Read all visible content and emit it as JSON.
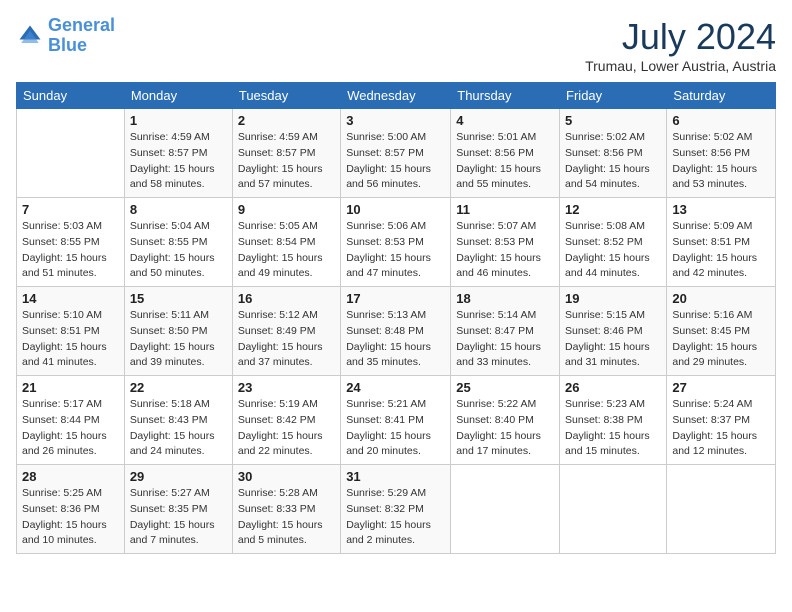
{
  "header": {
    "logo_line1": "General",
    "logo_line2": "Blue",
    "month": "July 2024",
    "location": "Trumau, Lower Austria, Austria"
  },
  "days_of_week": [
    "Sunday",
    "Monday",
    "Tuesday",
    "Wednesday",
    "Thursday",
    "Friday",
    "Saturday"
  ],
  "weeks": [
    [
      {
        "num": "",
        "info": ""
      },
      {
        "num": "1",
        "info": "Sunrise: 4:59 AM\nSunset: 8:57 PM\nDaylight: 15 hours\nand 58 minutes."
      },
      {
        "num": "2",
        "info": "Sunrise: 4:59 AM\nSunset: 8:57 PM\nDaylight: 15 hours\nand 57 minutes."
      },
      {
        "num": "3",
        "info": "Sunrise: 5:00 AM\nSunset: 8:57 PM\nDaylight: 15 hours\nand 56 minutes."
      },
      {
        "num": "4",
        "info": "Sunrise: 5:01 AM\nSunset: 8:56 PM\nDaylight: 15 hours\nand 55 minutes."
      },
      {
        "num": "5",
        "info": "Sunrise: 5:02 AM\nSunset: 8:56 PM\nDaylight: 15 hours\nand 54 minutes."
      },
      {
        "num": "6",
        "info": "Sunrise: 5:02 AM\nSunset: 8:56 PM\nDaylight: 15 hours\nand 53 minutes."
      }
    ],
    [
      {
        "num": "7",
        "info": "Sunrise: 5:03 AM\nSunset: 8:55 PM\nDaylight: 15 hours\nand 51 minutes."
      },
      {
        "num": "8",
        "info": "Sunrise: 5:04 AM\nSunset: 8:55 PM\nDaylight: 15 hours\nand 50 minutes."
      },
      {
        "num": "9",
        "info": "Sunrise: 5:05 AM\nSunset: 8:54 PM\nDaylight: 15 hours\nand 49 minutes."
      },
      {
        "num": "10",
        "info": "Sunrise: 5:06 AM\nSunset: 8:53 PM\nDaylight: 15 hours\nand 47 minutes."
      },
      {
        "num": "11",
        "info": "Sunrise: 5:07 AM\nSunset: 8:53 PM\nDaylight: 15 hours\nand 46 minutes."
      },
      {
        "num": "12",
        "info": "Sunrise: 5:08 AM\nSunset: 8:52 PM\nDaylight: 15 hours\nand 44 minutes."
      },
      {
        "num": "13",
        "info": "Sunrise: 5:09 AM\nSunset: 8:51 PM\nDaylight: 15 hours\nand 42 minutes."
      }
    ],
    [
      {
        "num": "14",
        "info": "Sunrise: 5:10 AM\nSunset: 8:51 PM\nDaylight: 15 hours\nand 41 minutes."
      },
      {
        "num": "15",
        "info": "Sunrise: 5:11 AM\nSunset: 8:50 PM\nDaylight: 15 hours\nand 39 minutes."
      },
      {
        "num": "16",
        "info": "Sunrise: 5:12 AM\nSunset: 8:49 PM\nDaylight: 15 hours\nand 37 minutes."
      },
      {
        "num": "17",
        "info": "Sunrise: 5:13 AM\nSunset: 8:48 PM\nDaylight: 15 hours\nand 35 minutes."
      },
      {
        "num": "18",
        "info": "Sunrise: 5:14 AM\nSunset: 8:47 PM\nDaylight: 15 hours\nand 33 minutes."
      },
      {
        "num": "19",
        "info": "Sunrise: 5:15 AM\nSunset: 8:46 PM\nDaylight: 15 hours\nand 31 minutes."
      },
      {
        "num": "20",
        "info": "Sunrise: 5:16 AM\nSunset: 8:45 PM\nDaylight: 15 hours\nand 29 minutes."
      }
    ],
    [
      {
        "num": "21",
        "info": "Sunrise: 5:17 AM\nSunset: 8:44 PM\nDaylight: 15 hours\nand 26 minutes."
      },
      {
        "num": "22",
        "info": "Sunrise: 5:18 AM\nSunset: 8:43 PM\nDaylight: 15 hours\nand 24 minutes."
      },
      {
        "num": "23",
        "info": "Sunrise: 5:19 AM\nSunset: 8:42 PM\nDaylight: 15 hours\nand 22 minutes."
      },
      {
        "num": "24",
        "info": "Sunrise: 5:21 AM\nSunset: 8:41 PM\nDaylight: 15 hours\nand 20 minutes."
      },
      {
        "num": "25",
        "info": "Sunrise: 5:22 AM\nSunset: 8:40 PM\nDaylight: 15 hours\nand 17 minutes."
      },
      {
        "num": "26",
        "info": "Sunrise: 5:23 AM\nSunset: 8:38 PM\nDaylight: 15 hours\nand 15 minutes."
      },
      {
        "num": "27",
        "info": "Sunrise: 5:24 AM\nSunset: 8:37 PM\nDaylight: 15 hours\nand 12 minutes."
      }
    ],
    [
      {
        "num": "28",
        "info": "Sunrise: 5:25 AM\nSunset: 8:36 PM\nDaylight: 15 hours\nand 10 minutes."
      },
      {
        "num": "29",
        "info": "Sunrise: 5:27 AM\nSunset: 8:35 PM\nDaylight: 15 hours\nand 7 minutes."
      },
      {
        "num": "30",
        "info": "Sunrise: 5:28 AM\nSunset: 8:33 PM\nDaylight: 15 hours\nand 5 minutes."
      },
      {
        "num": "31",
        "info": "Sunrise: 5:29 AM\nSunset: 8:32 PM\nDaylight: 15 hours\nand 2 minutes."
      },
      {
        "num": "",
        "info": ""
      },
      {
        "num": "",
        "info": ""
      },
      {
        "num": "",
        "info": ""
      }
    ]
  ]
}
